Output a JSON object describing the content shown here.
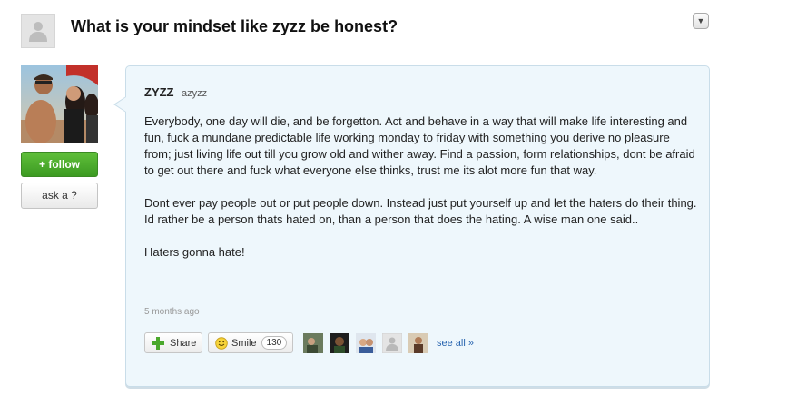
{
  "question": {
    "title": "What is your mindset like zyzz be honest?",
    "menu_icon": "chevron-down-icon",
    "asker_avatar": "default-user-icon"
  },
  "profile": {
    "photo": "profile-photo",
    "follow_label": "+ follow",
    "ask_label": "ask a ?"
  },
  "answer": {
    "author_name": "ZYZZ",
    "author_handle": "azyzz",
    "paragraphs": [
      "Everybody, one day will die, and be forgetton. Act and behave in a way that will make life interesting and fun, fuck a mundane predictable life working monday to friday with something you derive no pleasure from; just living life out till you grow old and wither away. Find a passion, form relationships, dont be afraid to get out there and fuck what everyone else thinks, trust me its alot more fun that way.",
      "Dont ever pay people out or put people down. Instead just put yourself up and let the haters do their thing. Id rather be a person thats hated on, than a person that does the hating. A wise man one said..",
      "Haters gonna hate!"
    ],
    "timestamp": "5 months ago"
  },
  "actions": {
    "share_label": "Share",
    "smile_label": "Smile",
    "smile_count": "130",
    "see_all_label": "see all »"
  },
  "colors": {
    "follow_green": "#4aa82c",
    "answer_bg": "#eef7fc",
    "answer_border": "#c9dde9",
    "link_blue": "#2a66b0"
  }
}
